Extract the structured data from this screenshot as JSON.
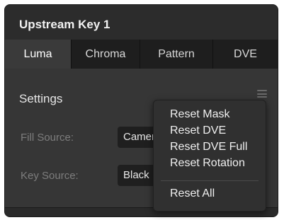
{
  "panel": {
    "title": "Upstream Key 1"
  },
  "tabs": [
    {
      "label": "Luma",
      "active": true
    },
    {
      "label": "Chroma",
      "active": false
    },
    {
      "label": "Pattern",
      "active": false
    },
    {
      "label": "DVE",
      "active": false
    }
  ],
  "settings": {
    "title": "Settings",
    "fill_source_label": "Fill Source:",
    "fill_source_value": "Camera",
    "key_source_label": "Key Source:",
    "key_source_value": "Black",
    "menu_icon": "hamburger-menu-icon"
  },
  "context_menu": {
    "items": [
      {
        "label": "Reset Mask"
      },
      {
        "label": "Reset DVE"
      },
      {
        "label": "Reset DVE Full"
      },
      {
        "label": "Reset Rotation"
      },
      {
        "label": "Reset All"
      }
    ]
  },
  "colors": {
    "panel_bg": "#2a2a2a",
    "content_bg": "#363636",
    "tab_active_bg": "#3a3a3a",
    "tabbar_bg": "#1e1e1e",
    "menu_bg": "#303030",
    "text": "#f0f0f0",
    "muted_text": "#7d7d7d"
  }
}
